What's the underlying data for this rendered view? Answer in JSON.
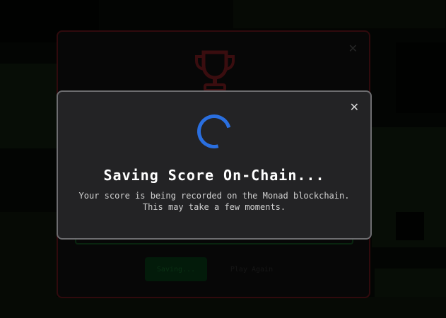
{
  "background": {
    "card": {
      "close_icon": "close-icon",
      "trophy_icon": "trophy-icon",
      "buttons": {
        "saving_label": "Saving...",
        "play_again_label": "Play Again"
      }
    }
  },
  "modal": {
    "title": "Saving Score On-Chain...",
    "message_line1": "Your score is being recorded on the Monad blockchain.",
    "message_line2": "This may take a few moments.",
    "close_icon": "close-icon",
    "spinner_icon": "loading-spinner-icon",
    "accent_color": "#2a6fe0"
  }
}
